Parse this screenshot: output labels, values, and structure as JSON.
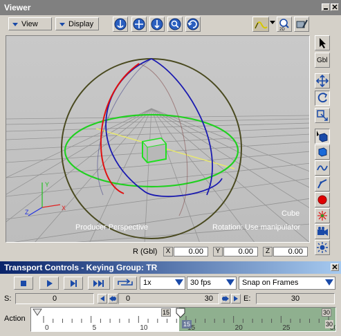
{
  "viewer": {
    "title": "Viewer",
    "menu_view": "View",
    "menu_display": "Display",
    "camera_label": "Producer Perspective",
    "selection_label": "Cube",
    "rotation_label": "Rotation: Use manipulator"
  },
  "side_toolbar": {
    "gbl_label": "Gbl"
  },
  "status_row": {
    "r_label": "R (Gbl)",
    "x_label": "X",
    "x_value": "0.00",
    "y_label": "Y",
    "y_value": "0.00",
    "z_label": "Z",
    "z_value": "0.00"
  },
  "transport": {
    "title": "Transport Controls  -  Keying Group: TR",
    "speed": "1x",
    "fps": "30 fps",
    "snap": "Snap on Frames",
    "start_label": "S:",
    "start_value": "0",
    "range_start": "0",
    "range_end": "30",
    "end_label": "E:",
    "end_value": "30",
    "action_label": "Action",
    "ruler_ticks": [
      "0",
      "5",
      "10",
      "15",
      "20",
      "25",
      "30"
    ],
    "marker_left": "15",
    "marker_right": "30",
    "marker_below_left": "15",
    "marker_below_right": "30"
  },
  "colors": {
    "panel": "#d4d0c8",
    "viewport_bg": "#c2c2c2",
    "title_active": "#0a246a",
    "accent_blue": "#1a4aa8",
    "timeline_green": "#8fb08f"
  }
}
